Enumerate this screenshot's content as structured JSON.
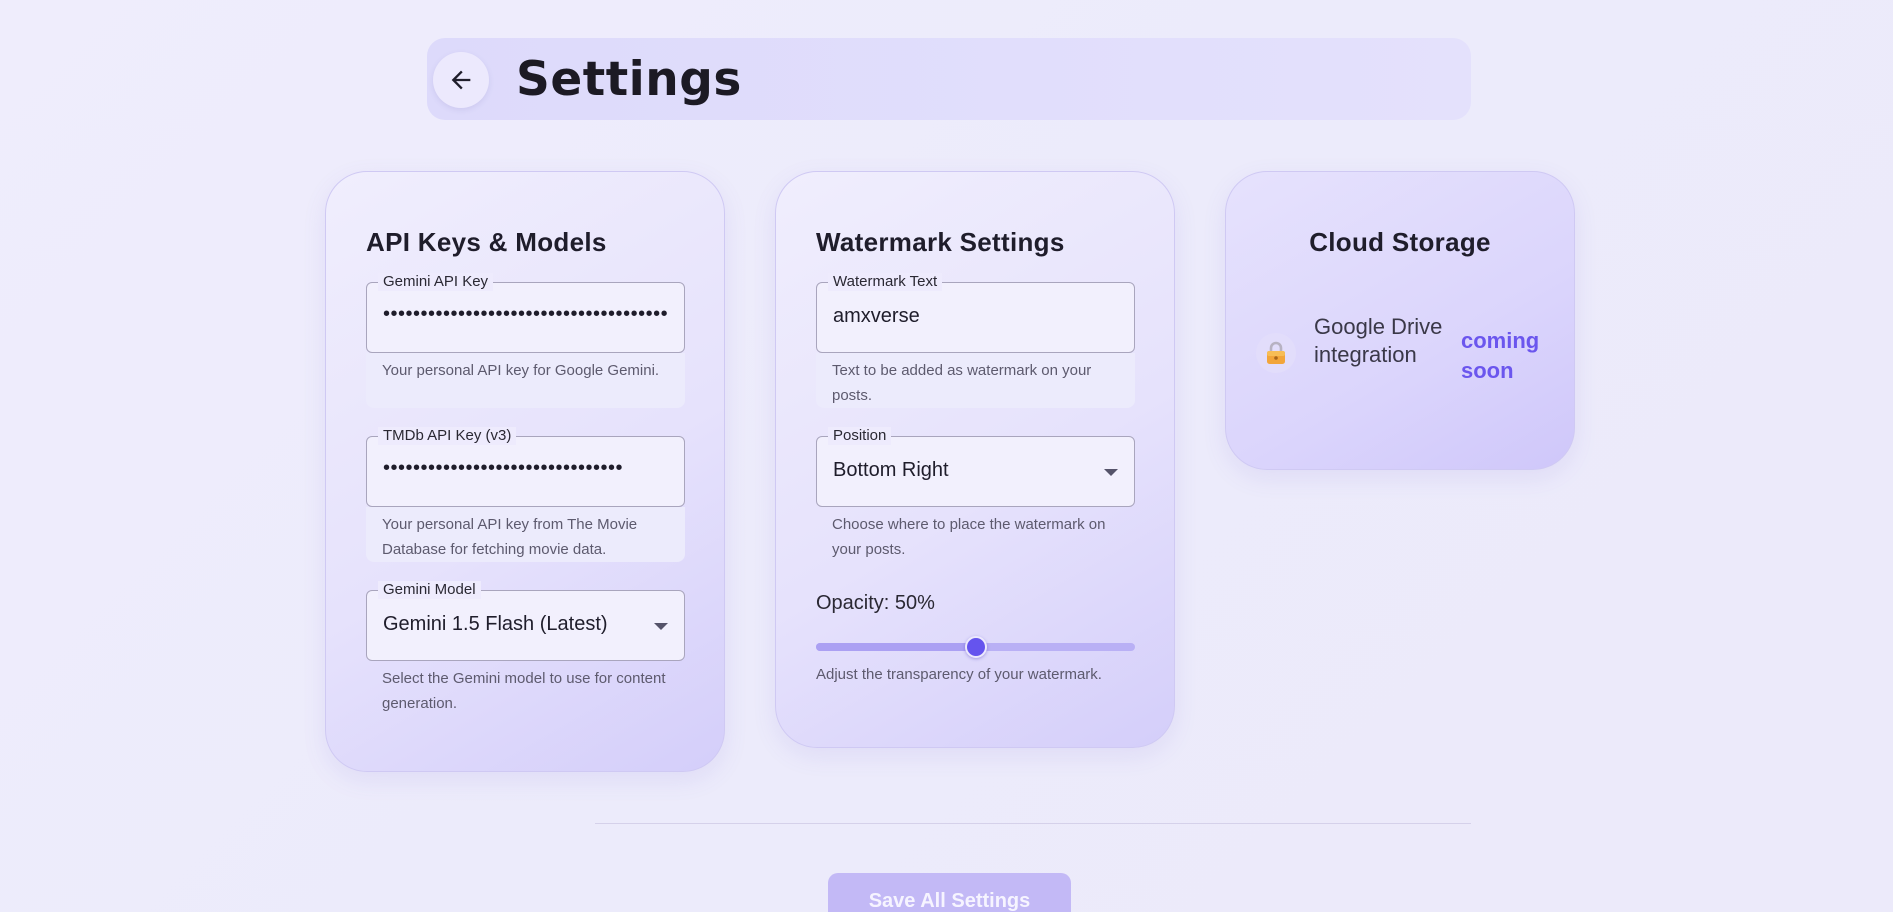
{
  "header": {
    "title": "Settings",
    "back_icon": "arrow-left-icon"
  },
  "api_card": {
    "title": "API Keys & Models",
    "gemini_key": {
      "label": "Gemini API Key",
      "value": "••••••••••••••••••••••••••••••••••••••",
      "helper": "Your personal API key for Google Gemini."
    },
    "tmdb_key": {
      "label": "TMDb API Key (v3)",
      "value": "••••••••••••••••••••••••••••••••",
      "helper": "Your personal API key from The Movie Database for fetching movie data."
    },
    "model": {
      "label": "Gemini Model",
      "value": "Gemini 1.5 Flash (Latest)",
      "helper": "Select the Gemini model to use for content generation."
    }
  },
  "watermark_card": {
    "title": "Watermark Settings",
    "text_field": {
      "label": "Watermark Text",
      "value": "amxverse",
      "helper": "Text to be added as watermark on your posts."
    },
    "position": {
      "label": "Position",
      "value": "Bottom Right",
      "helper": "Choose where to place the watermark on your posts."
    },
    "opacity": {
      "label": "Opacity: 50%",
      "value": 0.5,
      "helper": "Adjust the transparency of your watermark."
    }
  },
  "cloud_card": {
    "title": "Cloud Storage",
    "lock_icon": "lock-icon",
    "text": "Google Drive integration",
    "badge": "coming soon"
  },
  "footer": {
    "save_label": "Save All Settings"
  },
  "colors": {
    "accent": "#6554ee",
    "badge": "#6b56ee",
    "save_button": "#c3b9f6"
  }
}
